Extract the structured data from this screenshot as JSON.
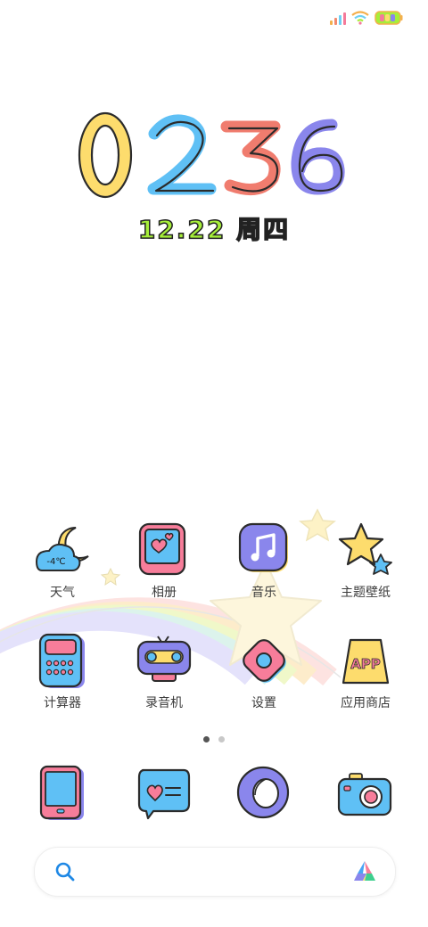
{
  "clock": {
    "digits": [
      "0",
      "2",
      "3",
      "6"
    ],
    "colors": [
      "#fddc6d",
      "#5fc0f5",
      "#f07c6e",
      "#8a86ec"
    ]
  },
  "date": {
    "text": "12.22 周四"
  },
  "apps": [
    {
      "label": "天气",
      "icon": "weather-icon",
      "badge": "-4℃"
    },
    {
      "label": "相册",
      "icon": "gallery-icon"
    },
    {
      "label": "音乐",
      "icon": "music-icon"
    },
    {
      "label": "主题壁纸",
      "icon": "themes-icon"
    },
    {
      "label": "计算器",
      "icon": "calculator-icon"
    },
    {
      "label": "录音机",
      "icon": "recorder-icon"
    },
    {
      "label": "设置",
      "icon": "settings-icon"
    },
    {
      "label": "应用商店",
      "icon": "app-store-icon",
      "badge": "APP"
    }
  ],
  "page_indicator": {
    "count": 2,
    "active": 0
  },
  "dock": [
    {
      "icon": "phone-icon"
    },
    {
      "icon": "messages-icon"
    },
    {
      "icon": "browser-icon"
    },
    {
      "icon": "camera-icon"
    }
  ],
  "search": {
    "icon": "search-icon",
    "assistant_icon": "assistant-logo-icon"
  },
  "colors": {
    "yellow": "#fddc6d",
    "blue": "#5fc0f5",
    "pink": "#f77d9a",
    "purple": "#8a86ec",
    "outline": "#2b2b2b",
    "green": "#a6ee3a"
  }
}
